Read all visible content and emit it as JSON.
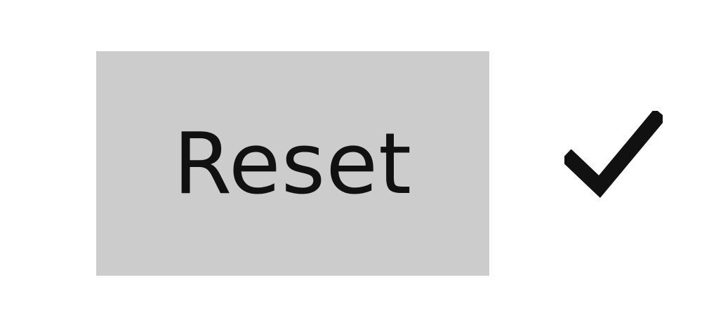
{
  "button": {
    "label": "Reset",
    "background_color": "#cccccc",
    "text_color": "#111111"
  },
  "status_icon": {
    "name": "check-icon",
    "color": "#111111"
  }
}
